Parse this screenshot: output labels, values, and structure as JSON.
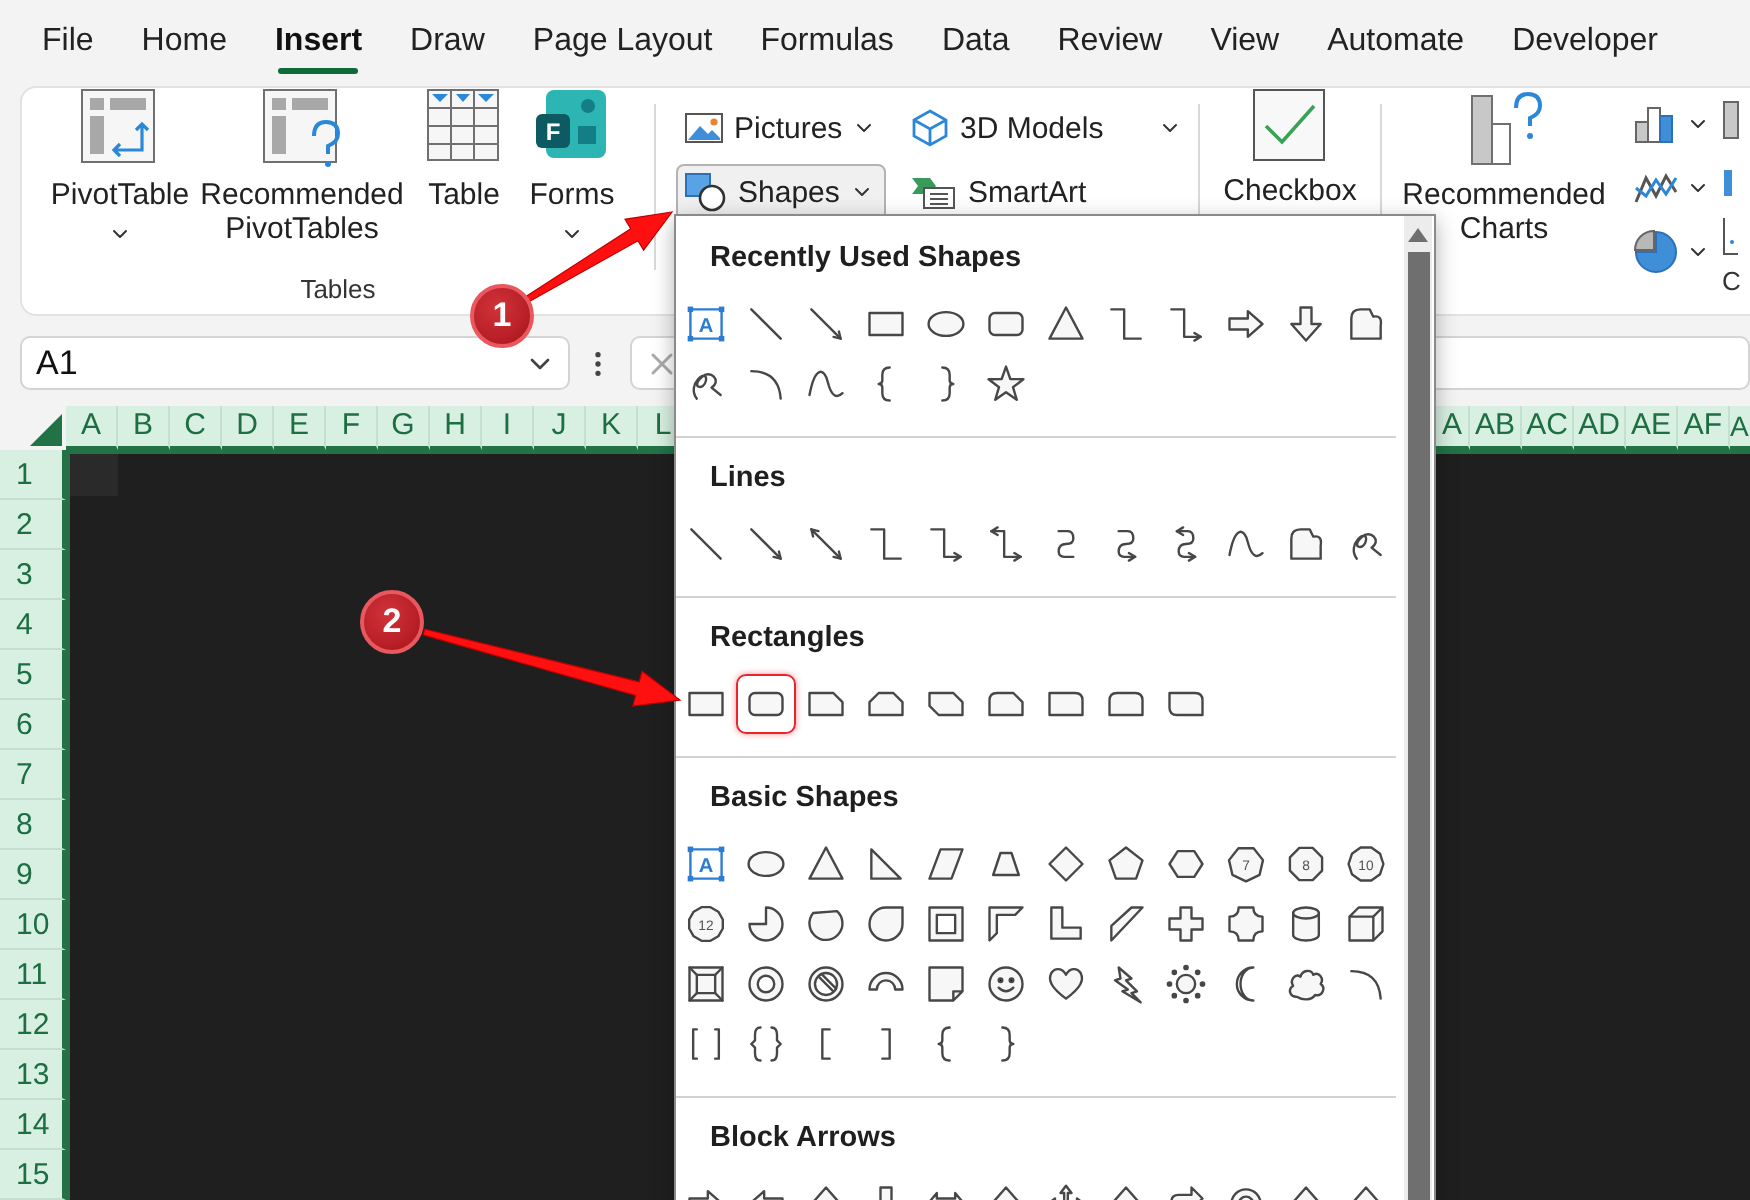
{
  "tabs": [
    {
      "label": "File",
      "selected": false
    },
    {
      "label": "Home",
      "selected": false
    },
    {
      "label": "Insert",
      "selected": true
    },
    {
      "label": "Draw",
      "selected": false
    },
    {
      "label": "Page Layout",
      "selected": false
    },
    {
      "label": "Formulas",
      "selected": false
    },
    {
      "label": "Data",
      "selected": false
    },
    {
      "label": "Review",
      "selected": false
    },
    {
      "label": "View",
      "selected": false
    },
    {
      "label": "Automate",
      "selected": false
    },
    {
      "label": "Developer",
      "selected": false
    }
  ],
  "ribbon": {
    "tables_group": {
      "label": "Tables",
      "items": [
        {
          "kind": "pivot",
          "label": "PivotTable",
          "dropdown": true
        },
        {
          "kind": "recommended-pivot",
          "label": "Recommended PivotTables",
          "dropdown": false
        },
        {
          "kind": "table",
          "label": "Table",
          "dropdown": false
        },
        {
          "kind": "forms",
          "label": "Forms",
          "icon_letter": "F",
          "dropdown": true
        }
      ]
    },
    "illustrations": [
      {
        "kind": "pictures",
        "label": "Pictures",
        "dropdown": true,
        "pressed": false
      },
      {
        "kind": "models",
        "label": "3D Models",
        "dropdown": true,
        "pressed": false
      },
      {
        "kind": "shapes",
        "label": "Shapes",
        "dropdown": true,
        "pressed": true
      },
      {
        "kind": "smartart",
        "label": "SmartArt",
        "dropdown": false,
        "pressed": false
      }
    ],
    "checkbox": {
      "label": "Checkbox"
    },
    "charts": {
      "recommended": "Recommended Charts",
      "group_label": "C"
    }
  },
  "name_box": {
    "value": "A1"
  },
  "columns_left": [
    "A",
    "B",
    "C",
    "D",
    "E",
    "F",
    "G",
    "H",
    "I",
    "J",
    "K",
    "L"
  ],
  "columns_right": [
    "A",
    "AB",
    "AC",
    "AD",
    "AE",
    "AF",
    "A"
  ],
  "rows": [
    "1",
    "2",
    "3",
    "4",
    "5",
    "6",
    "7",
    "8",
    "9",
    "10",
    "11",
    "12",
    "13",
    "14",
    "15"
  ],
  "shapes_menu": {
    "sections": [
      {
        "title": "Recently Used Shapes",
        "shapes": [
          {
            "kind": "text-box",
            "label": "A"
          },
          {
            "kind": "line"
          },
          {
            "kind": "arrow-line"
          },
          {
            "kind": "rectangle"
          },
          {
            "kind": "oval"
          },
          {
            "kind": "rounded-rectangle"
          },
          {
            "kind": "triangle"
          },
          {
            "kind": "elbow-connector"
          },
          {
            "kind": "elbow-arrow"
          },
          {
            "kind": "right-arrow"
          },
          {
            "kind": "down-arrow"
          },
          {
            "kind": "freeform"
          },
          {
            "kind": "scribble"
          },
          {
            "kind": "arc"
          },
          {
            "kind": "curve"
          },
          {
            "kind": "left-brace"
          },
          {
            "kind": "right-brace"
          },
          {
            "kind": "star"
          }
        ]
      },
      {
        "title": "Lines",
        "shapes": [
          {
            "kind": "line"
          },
          {
            "kind": "arrow-line"
          },
          {
            "kind": "double-arrow-line"
          },
          {
            "kind": "elbow-connector"
          },
          {
            "kind": "elbow-arrow"
          },
          {
            "kind": "elbow-double-arrow"
          },
          {
            "kind": "curved-connector"
          },
          {
            "kind": "curved-arrow"
          },
          {
            "kind": "curved-double-arrow"
          },
          {
            "kind": "curve"
          },
          {
            "kind": "freeform"
          },
          {
            "kind": "scribble"
          }
        ]
      },
      {
        "title": "Rectangles",
        "shapes": [
          {
            "kind": "rectangle",
            "highlighted": false
          },
          {
            "kind": "rounded-rectangle",
            "highlighted": true
          },
          {
            "kind": "snip-corner",
            "highlighted": false
          },
          {
            "kind": "snip-same-side",
            "highlighted": false
          },
          {
            "kind": "snip-diagonal",
            "highlighted": false
          },
          {
            "kind": "snip-round",
            "highlighted": false
          },
          {
            "kind": "round-corner",
            "highlighted": false
          },
          {
            "kind": "round-same-side",
            "highlighted": false
          },
          {
            "kind": "round-diagonal",
            "highlighted": false
          }
        ]
      },
      {
        "title": "Basic Shapes",
        "shapes": [
          {
            "kind": "text-box",
            "label": "A"
          },
          {
            "kind": "oval"
          },
          {
            "kind": "triangle"
          },
          {
            "kind": "right-triangle"
          },
          {
            "kind": "parallelogram"
          },
          {
            "kind": "trapezoid"
          },
          {
            "kind": "diamond"
          },
          {
            "kind": "pentagon"
          },
          {
            "kind": "hexagon"
          },
          {
            "kind": "heptagon",
            "label": "7"
          },
          {
            "kind": "octagon",
            "label": "8"
          },
          {
            "kind": "decagon",
            "label": "10"
          },
          {
            "kind": "dodecagon",
            "label": "12"
          },
          {
            "kind": "pie"
          },
          {
            "kind": "chord"
          },
          {
            "kind": "teardrop"
          },
          {
            "kind": "frame"
          },
          {
            "kind": "half-frame"
          },
          {
            "kind": "l-shape"
          },
          {
            "kind": "diagonal-stripe"
          },
          {
            "kind": "cross"
          },
          {
            "kind": "plaque"
          },
          {
            "kind": "can"
          },
          {
            "kind": "cube"
          },
          {
            "kind": "bevel"
          },
          {
            "kind": "donut"
          },
          {
            "kind": "no-symbol"
          },
          {
            "kind": "block-arc"
          },
          {
            "kind": "folded-corner"
          },
          {
            "kind": "smiley"
          },
          {
            "kind": "heart"
          },
          {
            "kind": "lightning"
          },
          {
            "kind": "sun"
          },
          {
            "kind": "moon"
          },
          {
            "kind": "cloud"
          },
          {
            "kind": "arc"
          },
          {
            "kind": "double-bracket"
          },
          {
            "kind": "double-brace"
          },
          {
            "kind": "left-bracket"
          },
          {
            "kind": "right-bracket"
          },
          {
            "kind": "left-brace"
          },
          {
            "kind": "right-brace"
          }
        ]
      },
      {
        "title": "Block Arrows",
        "shapes": [
          {
            "kind": "right-arrow"
          },
          {
            "kind": "left-arrow"
          },
          {
            "kind": "up-arrow"
          },
          {
            "kind": "down-arrow"
          },
          {
            "kind": "left-right-arrow"
          },
          {
            "kind": "up-arrow"
          },
          {
            "kind": "quad-arrow"
          },
          {
            "kind": "up-arrow"
          },
          {
            "kind": "bent-arrow"
          },
          {
            "kind": "circular-arrow"
          },
          {
            "kind": "up-arrow"
          },
          {
            "kind": "up-arrow"
          }
        ]
      }
    ]
  },
  "annotations": [
    {
      "number": "1"
    },
    {
      "number": "2"
    }
  ]
}
